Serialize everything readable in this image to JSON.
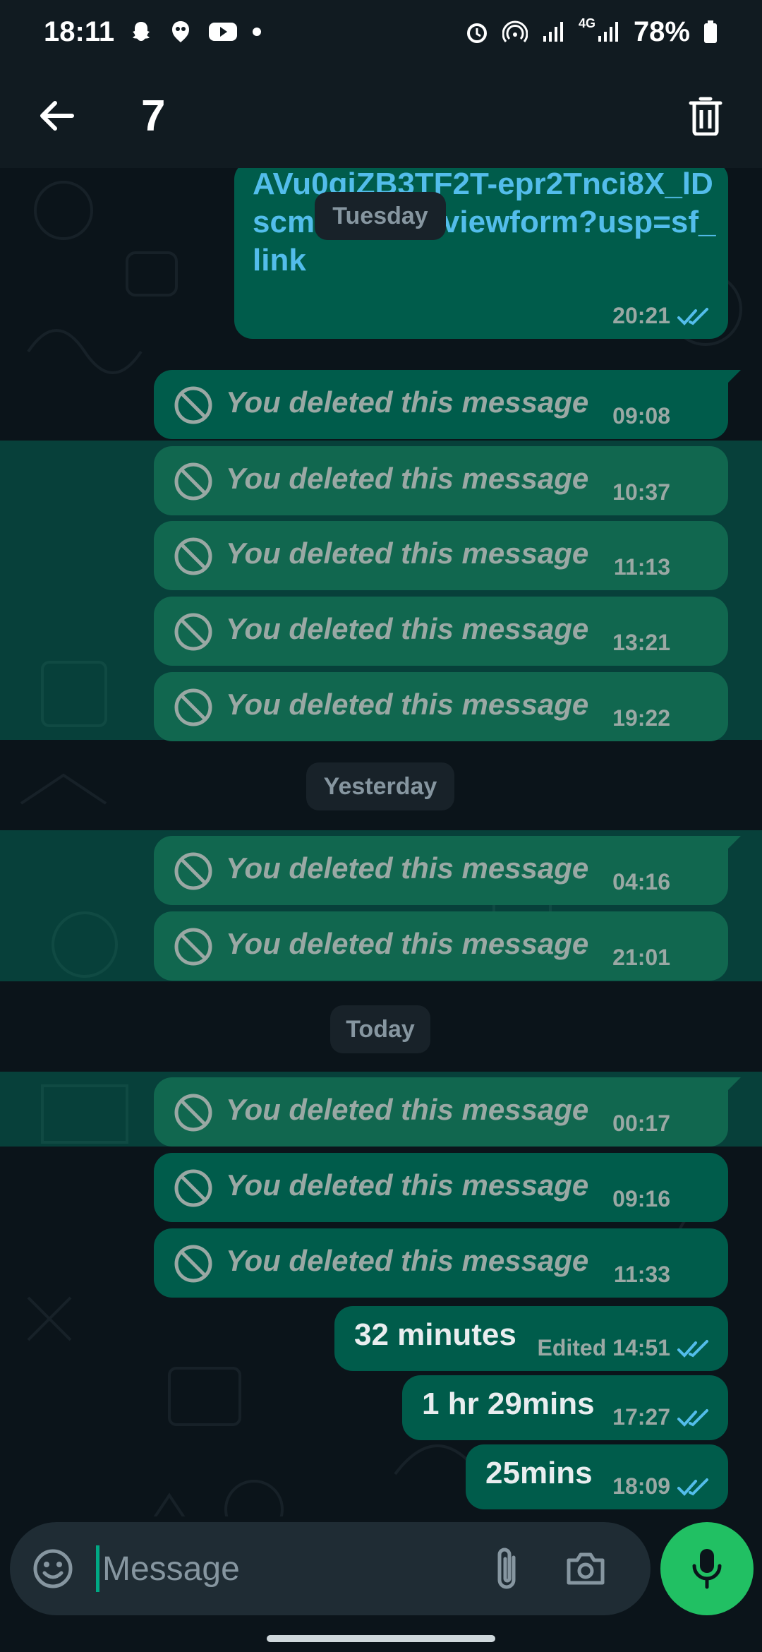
{
  "status_bar": {
    "time": "18:11",
    "network": "4G",
    "battery": "78%",
    "icons_left": [
      "snapchat-icon",
      "ghost-icon",
      "youtube-icon",
      "dot"
    ],
    "icons_right": [
      "alarm-icon",
      "hotspot-icon",
      "signal-icon",
      "signal-4g-icon",
      "signal-icon",
      "battery-icon"
    ]
  },
  "app_bar": {
    "selected_count": "7",
    "back_icon": "arrow-left-icon",
    "delete_icon": "trash-icon"
  },
  "chat": {
    "link_message": {
      "text": "AVu0qiZB3TF2T-epr2Tnci8X_lDscmwZMMQ/viewform?usp=sf_link",
      "time": "20:21",
      "status": "read"
    },
    "deleted_text": "You deleted this message",
    "dates": {
      "tuesday": "Tuesday",
      "yesterday": "Yesterday",
      "today": "Today"
    },
    "deleted_times": [
      "09:08",
      "10:37",
      "11:13",
      "13:21",
      "19:22",
      "04:16",
      "21:01",
      "00:17",
      "09:16",
      "11:33"
    ],
    "messages": [
      {
        "text": "32 minutes",
        "meta": "Edited 14:51",
        "status": "read"
      },
      {
        "text": "1 hr 29mins",
        "meta": "17:27",
        "status": "read"
      },
      {
        "text": "25mins",
        "meta": "18:09",
        "status": "read"
      }
    ]
  },
  "input": {
    "placeholder": "Message",
    "value": ""
  },
  "colors": {
    "background": "#0b141a",
    "header": "#111b21",
    "outgoing_bubble": "#005c4b",
    "selection": "#00a884",
    "link": "#53bdeb",
    "read_tick": "#53bdeb",
    "mic_button": "#21c063"
  }
}
